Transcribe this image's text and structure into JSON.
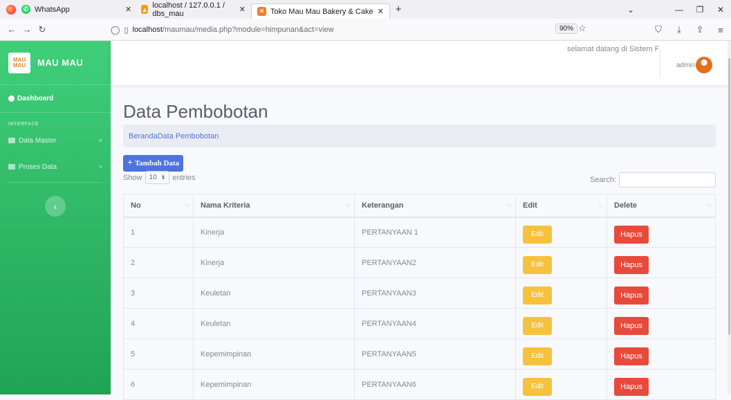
{
  "browser": {
    "tabs": [
      {
        "label": "WhatsApp",
        "icon": "whatsapp-icon",
        "color": "#25d366"
      },
      {
        "label": "localhost / 127.0.0.1 / dbs_mau",
        "icon": "phpmyadmin-icon",
        "color": "#f89c0e"
      },
      {
        "label": "Toko Mau Mau Bakery & Cake",
        "icon": "xampp-icon",
        "color": "#fb7a24"
      }
    ],
    "url_host": "localhost",
    "url_path": "/maumau/media.php?module=himpunan&act=view",
    "zoom": "90%"
  },
  "sidebar": {
    "brand_logo": "MAU MAU",
    "brand": "MAU MAU",
    "dashboard": "Dashboard",
    "heading": "INTERFACE",
    "items": [
      {
        "label": "Data Master"
      },
      {
        "label": "Proses Data"
      }
    ]
  },
  "topbar": {
    "welcome": "selamat datang di Sistem Pendukung Keputusan",
    "user": "admin"
  },
  "main": {
    "title": "Data Pembobotan",
    "breadcrumb": "BerandaData Pembobotan",
    "add_button": "Tambah Data",
    "show_label": "Show",
    "entries_value": "10",
    "entries_label": "entries",
    "search_label": "Search:",
    "columns": [
      "No",
      "Nama Kriteria",
      "Keterangan",
      "Edit",
      "Delete"
    ],
    "rows": [
      {
        "no": "1",
        "nama": "Kinerja",
        "ket": "PERTANYAAN 1",
        "edit": "Edit",
        "delete": "Hapus"
      },
      {
        "no": "2",
        "nama": "Kinerja",
        "ket": "PERTANYAAN2",
        "edit": "Edit",
        "delete": "Hapus"
      },
      {
        "no": "3",
        "nama": "Keuletan",
        "ket": "PERTANYAAN3",
        "edit": "Edit",
        "delete": "Hapus"
      },
      {
        "no": "4",
        "nama": "Keuletan",
        "ket": "PERTANYAAN4",
        "edit": "Edit",
        "delete": "Hapus"
      },
      {
        "no": "5",
        "nama": "Kepemimpinan",
        "ket": "PERTANYAAN5",
        "edit": "Edit",
        "delete": "Hapus"
      },
      {
        "no": "6",
        "nama": "Kepemimpinan",
        "ket": "PERTANYAAN6",
        "edit": "Edit",
        "delete": "Hapus"
      }
    ]
  },
  "colors": {
    "sidebar": "#2db463",
    "primary": "#4e73df",
    "warning": "#f6c23e",
    "danger": "#e74a3b"
  }
}
